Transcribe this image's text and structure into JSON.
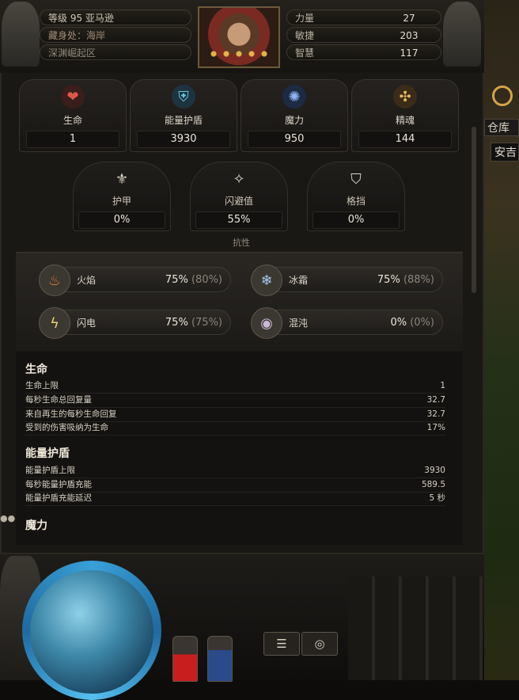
{
  "header": {
    "level_line": "等级 95 亚马逊",
    "stash_line": "藏身处：海岸",
    "zone_line": "深渊崛起区",
    "attributes": [
      {
        "label": "力量",
        "value": "27"
      },
      {
        "label": "敏捷",
        "value": "203"
      },
      {
        "label": "智慧",
        "value": "117"
      }
    ]
  },
  "primary": [
    {
      "label": "生命",
      "value": "1",
      "icon": "heart-icon",
      "color": "#c0392b"
    },
    {
      "label": "能量护盾",
      "value": "3930",
      "icon": "shield-icon",
      "color": "#4aa3c8"
    },
    {
      "label": "魔力",
      "value": "950",
      "icon": "mana-icon",
      "color": "#4a7fd6"
    },
    {
      "label": "精魂",
      "value": "144",
      "icon": "spirit-icon",
      "color": "#d6a24a"
    }
  ],
  "defence": [
    {
      "label": "护甲",
      "value": "0%",
      "icon": "armour-icon"
    },
    {
      "label": "闪避值",
      "value": "55%",
      "icon": "evasion-icon"
    },
    {
      "label": "格挡",
      "value": "0%",
      "icon": "block-icon"
    }
  ],
  "resistances": {
    "title": "抗性",
    "items": [
      {
        "label": "火焰",
        "value": "75%",
        "max": "(80%)",
        "icon": "fire-icon",
        "color": "#e0793a"
      },
      {
        "label": "冰霜",
        "value": "75%",
        "max": "(88%)",
        "icon": "cold-icon",
        "color": "#a8c8e8"
      },
      {
        "label": "闪电",
        "value": "75%",
        "max": "(75%)",
        "icon": "lightning-icon",
        "color": "#e8d070"
      },
      {
        "label": "混沌",
        "value": "0%",
        "max": "(0%)",
        "icon": "chaos-icon",
        "color": "#c8b8d8"
      }
    ]
  },
  "details": {
    "sections": [
      {
        "title": "生命",
        "rows": [
          {
            "k": "生命上限",
            "v": "1"
          },
          {
            "k": "每秒生命总回复量",
            "v": "32.7"
          },
          {
            "k": "来自再生的每秒生命回复",
            "v": "32.7"
          },
          {
            "k": "受到的伤害吸纳为生命",
            "v": "17%"
          }
        ]
      },
      {
        "title": "能量护盾",
        "rows": [
          {
            "k": "能量护盾上限",
            "v": "3930"
          },
          {
            "k": "每秒能量护盾充能",
            "v": "589.5"
          },
          {
            "k": "能量护盾充能延迟",
            "v": "5 秒"
          }
        ]
      },
      {
        "title": "魔力",
        "rows": []
      }
    ]
  },
  "world": {
    "sign": "仓库",
    "sign2": "安吉"
  },
  "hud": {
    "menu_glyph": "☰",
    "ring_glyph": "◎"
  }
}
